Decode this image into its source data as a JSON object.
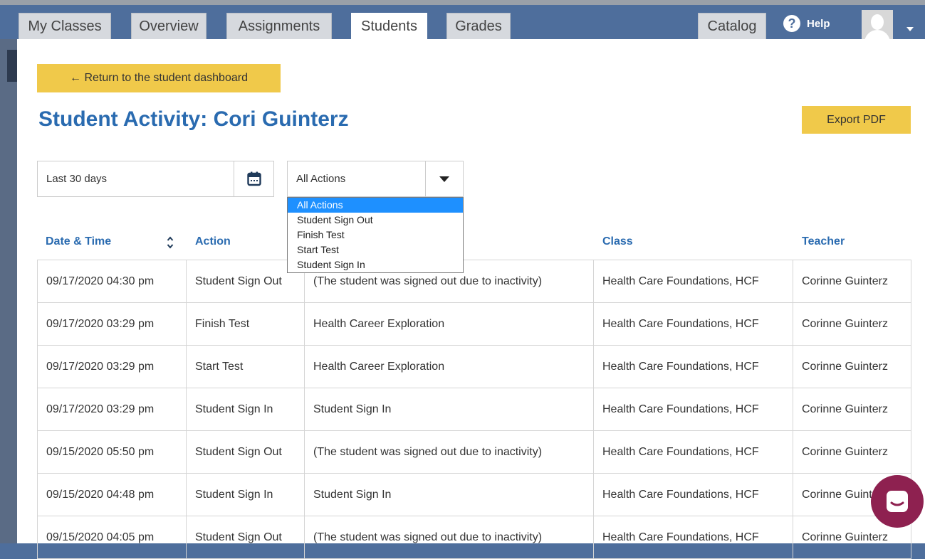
{
  "nav": {
    "tabs": [
      {
        "label": "My Classes"
      },
      {
        "label": "Overview"
      },
      {
        "label": "Assignments"
      },
      {
        "label": "Students"
      },
      {
        "label": "Grades"
      }
    ],
    "catalog": "Catalog",
    "help": "Help",
    "help_symbol": "?"
  },
  "page": {
    "return_label": "← Return to the student dashboard",
    "title": "Student Activity: Cori Guinterz",
    "export_label": "Export PDF"
  },
  "filters": {
    "date_range": "Last 30 days",
    "action_selected": "All Actions",
    "action_options": [
      "All Actions",
      "Student Sign Out",
      "Finish Test",
      "Start Test",
      "Student Sign In"
    ]
  },
  "table": {
    "headers": [
      "Date & Time",
      "Action",
      "",
      "Class",
      "Teacher"
    ],
    "rows": [
      [
        "09/17/2020 04:30 pm",
        "Student Sign Out",
        "(The student was signed out due to inactivity)",
        "Health Care Foundations, HCF",
        "Corinne Guinterz"
      ],
      [
        "09/17/2020 03:29 pm",
        "Finish Test",
        "Health Career Exploration",
        "Health Care Foundations, HCF",
        "Corinne Guinterz"
      ],
      [
        "09/17/2020 03:29 pm",
        "Start Test",
        "Health Career Exploration",
        "Health Care Foundations, HCF",
        "Corinne Guinterz"
      ],
      [
        "09/17/2020 03:29 pm",
        "Student Sign In",
        "Student Sign In",
        "Health Care Foundations, HCF",
        "Corinne Guinterz"
      ],
      [
        "09/15/2020 05:50 pm",
        "Student Sign Out",
        "(The student was signed out due to inactivity)",
        "Health Care Foundations, HCF",
        "Corinne Guinterz"
      ],
      [
        "09/15/2020 04:48 pm",
        "Student Sign In",
        "Student Sign In",
        "Health Care Foundations, HCF",
        "Corinne Guinterz"
      ],
      [
        "09/15/2020 04:05 pm",
        "Student Sign Out",
        "(The student was signed out due to inactivity)",
        "Health Care Foundations, HCF",
        "Corinne Guinterz"
      ]
    ]
  },
  "colors": {
    "nav_bg": "#4e6e9c",
    "accent_blue": "#2a6bb0",
    "button_yellow": "#f0c94a",
    "dropdown_highlight": "#1e90ff",
    "chat_bubble": "#8e2150"
  },
  "icons": {
    "calendar": "calendar-icon",
    "sort": "sort-icon",
    "dropdown_arrow": "chevron-down-icon",
    "help": "help-icon",
    "user": "avatar",
    "chat": "chat-icon"
  }
}
